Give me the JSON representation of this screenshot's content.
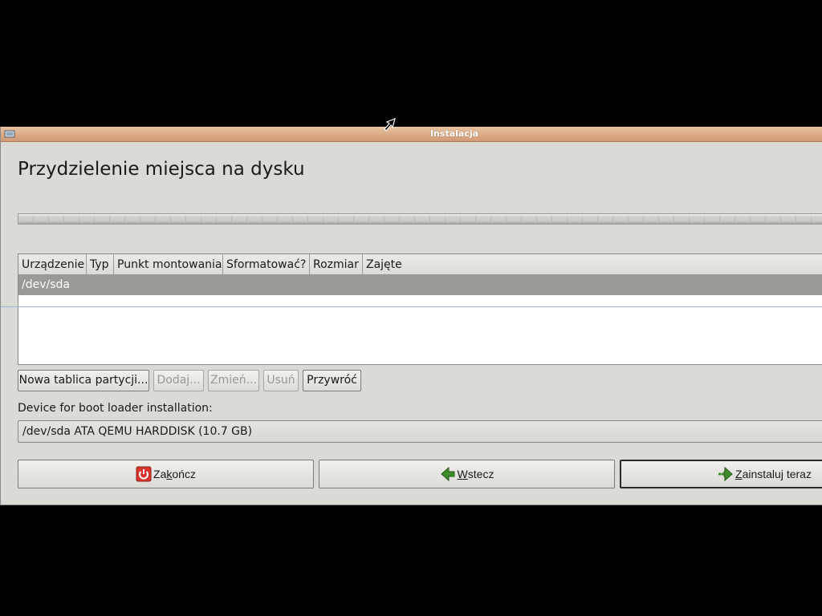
{
  "window": {
    "title": "Instalacja"
  },
  "page": {
    "heading": "Przydzielenie miejsca na dysku"
  },
  "partition_table": {
    "columns": [
      "Urządzenie",
      "Typ",
      "Punkt montowania",
      "Sformatować?",
      "Rozmiar",
      "Zajęte"
    ],
    "rows": [
      {
        "device": "/dev/sda",
        "selected": true
      }
    ]
  },
  "partition_buttons": {
    "new_table": "Nowa tablica partycji...",
    "add": "Dodaj...",
    "change": "Zmień...",
    "delete": "Usuń",
    "revert": "Przywróć"
  },
  "bootloader": {
    "label": "Device for boot loader installation:",
    "selected": "/dev/sda ATA QEMU HARDDISK (10.7 GB)"
  },
  "nav": {
    "quit_prefix": "Za",
    "quit_mnemonic": "k",
    "quit_suffix": "ończ",
    "back_mnemonic": "W",
    "back_suffix": "stecz",
    "install_mnemonic": "Z",
    "install_suffix": "ainstaluj teraz"
  },
  "colors": {
    "titlebar": "#d9a883",
    "selection": "#9c9a96",
    "quit_icon": "#d9342b",
    "arrow_icon": "#3d8a2a"
  },
  "icons": {
    "titlebar": "app-icon",
    "quit": "power-icon",
    "back": "arrow-left-icon",
    "install": "arrow-right-icon",
    "cursor": "mouse-cursor-icon"
  }
}
